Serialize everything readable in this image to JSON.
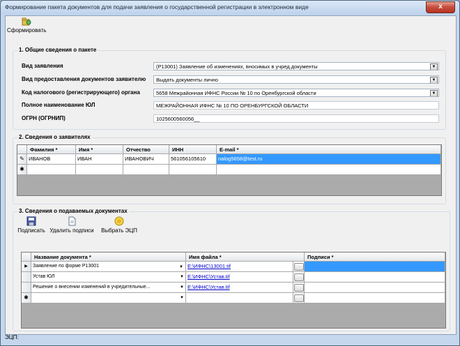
{
  "window": {
    "title": "Формирование пакета документов для подачи заявления о государственной регистрации в электронном виде",
    "close_label": "x"
  },
  "toolbar": {
    "generate_label": "Сформировать"
  },
  "section1": {
    "title": "1. Общие сведения о пакете",
    "fields": [
      {
        "label": "Вид заявления",
        "value": "(Р13001) Заявление об изменениях, вносимых в учред.документы"
      },
      {
        "label": "Вид предоставления документов заявителю",
        "value": "Выдать документы лично"
      },
      {
        "label": "Код налогового (регистрирующего) органа",
        "value": "5658 Межрайонная ИФНС России № 10 по Оренбургской области"
      },
      {
        "label": "Полное наименование ЮЛ",
        "value": "МЕЖРАЙОННАЯ ИФНС № 10 ПО ОРЕНБУРГСКОЙ ОБЛАСТИ"
      },
      {
        "label": "ОГРН (ОГРНИП)",
        "value": "1025600560056__"
      }
    ]
  },
  "section2": {
    "title": "2. Сведения о заявителях",
    "columns": [
      "Фамилия *",
      "Имя *",
      "Отчество",
      "ИНН",
      "E-mail *"
    ],
    "rows": [
      [
        "ИВАНОВ",
        "ИВАН",
        "ИВАНОВИЧ",
        "561056105610",
        "nalog5658@test.ru"
      ]
    ]
  },
  "section3": {
    "title": "3. Сведения о подаваемых документах",
    "toolbar": {
      "sign_label": "Подписать",
      "delete_signatures_label": "Удалить подписи",
      "choose_ecp_label": "Выбрать ЭЦП"
    },
    "columns": [
      "Название документа *",
      "Имя файла *",
      "Подписи *"
    ],
    "rows": [
      {
        "name": "Заявление по форме Р13001",
        "file": "E:\\ИФНС\\13001.tif"
      },
      {
        "name": "Устав ЮЛ",
        "file": "E:\\ИФНС\\Устав.tif"
      },
      {
        "name": "Решение о внесении изменений в учредительные...",
        "file": "E:\\ИФНС\\Устав.tif"
      }
    ]
  },
  "status": {
    "ecp_label": "ЭЦП:"
  },
  "icons": {
    "row_pointer": "▶",
    "new_row": "✱",
    "edit_row": "✎",
    "dropdown": "▼"
  }
}
